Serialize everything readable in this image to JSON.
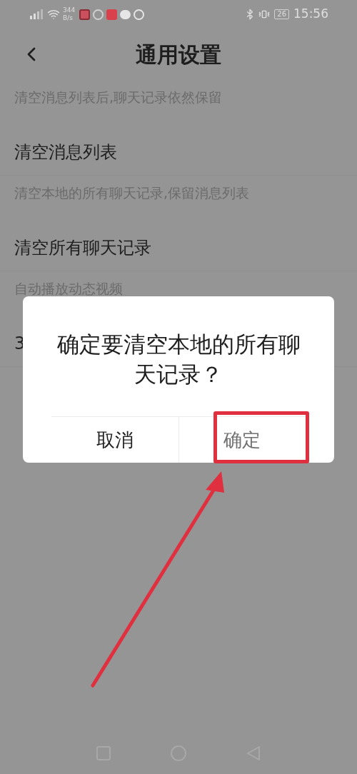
{
  "status_bar": {
    "net_speed_value": "344",
    "net_speed_unit": "B/s",
    "battery": "26",
    "time": "15:56"
  },
  "header": {
    "title": "通用设置"
  },
  "settings": [
    {
      "kind": "hint",
      "text": "清空消息列表后,聊天记录依然保留"
    },
    {
      "kind": "item",
      "text": "清空消息列表"
    },
    {
      "kind": "hint",
      "text": "清空本地的所有聊天记录,保留消息列表"
    },
    {
      "kind": "item",
      "text": "清空所有聊天记录"
    },
    {
      "kind": "hint",
      "text": "自动播放动态视频"
    },
    {
      "kind": "item",
      "text": "3"
    }
  ],
  "dialog": {
    "message": "确定要清空本地的所有聊天记录？",
    "buttons": [
      {
        "label": "取消",
        "highlighted": false,
        "dimmed": false
      },
      {
        "label": "确定",
        "highlighted": true,
        "dimmed": true
      }
    ]
  }
}
